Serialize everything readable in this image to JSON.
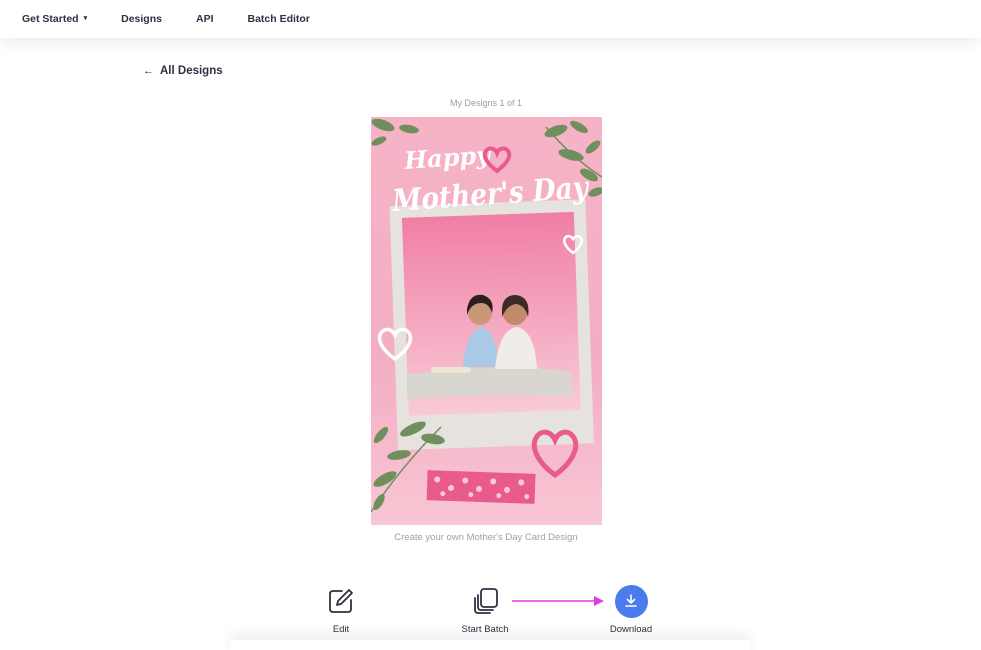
{
  "nav": {
    "items": [
      {
        "label": "Get Started",
        "has_dropdown": true
      },
      {
        "label": "Designs"
      },
      {
        "label": "API"
      },
      {
        "label": "Batch Editor"
      }
    ],
    "dropdown_caret": "▾"
  },
  "back": {
    "arrow": "←",
    "label": "All Designs"
  },
  "counter": "My Designs 1 of 1",
  "design": {
    "title_line1": "Happy",
    "title_line2": "Mother's Day",
    "caption": "Create your own Mother's Day Card Design",
    "colors": {
      "background": "#f5b8c9",
      "accent": "#ea5b8d",
      "frame": "#e6e3df",
      "leaf": "#6f8f5e"
    }
  },
  "actions": [
    {
      "label": "Edit",
      "icon": "edit-icon"
    },
    {
      "label": "Start Batch",
      "icon": "copy-stack-icon"
    },
    {
      "label": "Download",
      "icon": "download-icon"
    }
  ],
  "colors": {
    "primary": "#4b7bec",
    "annotation": "#e23be0",
    "muted_text": "#9aa0ac",
    "text": "#2d3142"
  }
}
